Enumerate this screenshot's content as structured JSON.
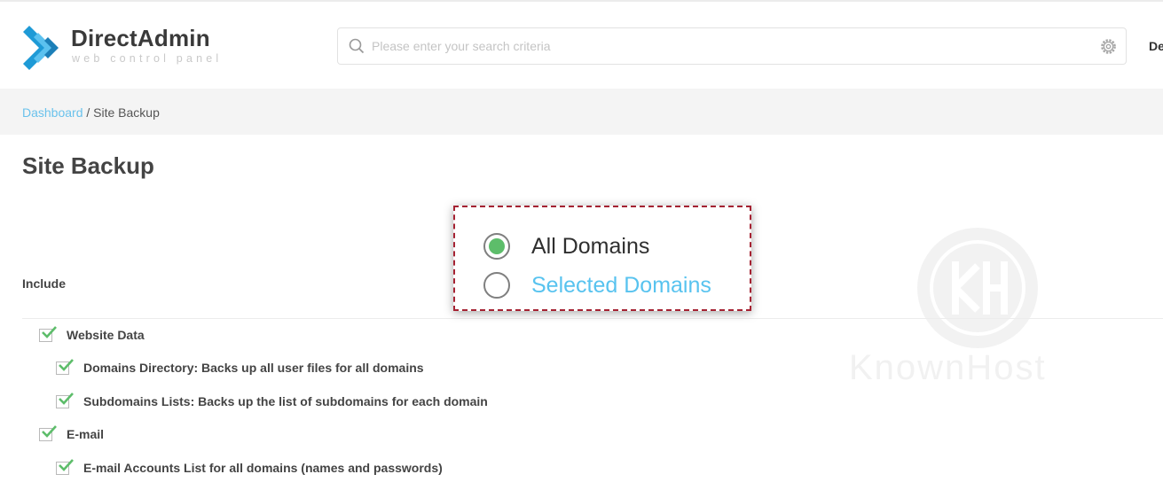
{
  "app": {
    "brand_name": "DirectAdmin",
    "brand_tagline": "web control panel",
    "user_truncated": "De"
  },
  "search": {
    "placeholder": "Please enter your search criteria",
    "value": ""
  },
  "breadcrumb": {
    "root": "Dashboard",
    "separator": " / ",
    "current": "Site Backup"
  },
  "page": {
    "title": "Site Backup"
  },
  "domain_scope": {
    "options": [
      {
        "label": "All Domains",
        "selected": true
      },
      {
        "label": "Selected Domains",
        "selected": false
      }
    ]
  },
  "include": {
    "label": "Include",
    "items": [
      {
        "label": "Website Data",
        "checked": true,
        "level": 0
      },
      {
        "label": "Domains Directory: Backs up all user files for all domains",
        "checked": true,
        "level": 1
      },
      {
        "label": "Subdomains Lists: Backs up the list of subdomains for each domain",
        "checked": true,
        "level": 1
      },
      {
        "label": "E-mail",
        "checked": true,
        "level": 0
      },
      {
        "label": "E-mail Accounts List for all domains (names and passwords)",
        "checked": true,
        "level": 1
      }
    ]
  },
  "watermark": {
    "text": "KnownHost"
  },
  "colors": {
    "accent_link": "#6ac2ec",
    "radio_selected": "#5dbd6a",
    "callout_border": "#a52232",
    "brand_blue": "#1e9ad6"
  },
  "icons": [
    "directadmin-logo-icon",
    "search-icon",
    "gear-icon",
    "checkbox-checked-icon",
    "radio-icon",
    "knownhost-watermark-icon"
  ]
}
